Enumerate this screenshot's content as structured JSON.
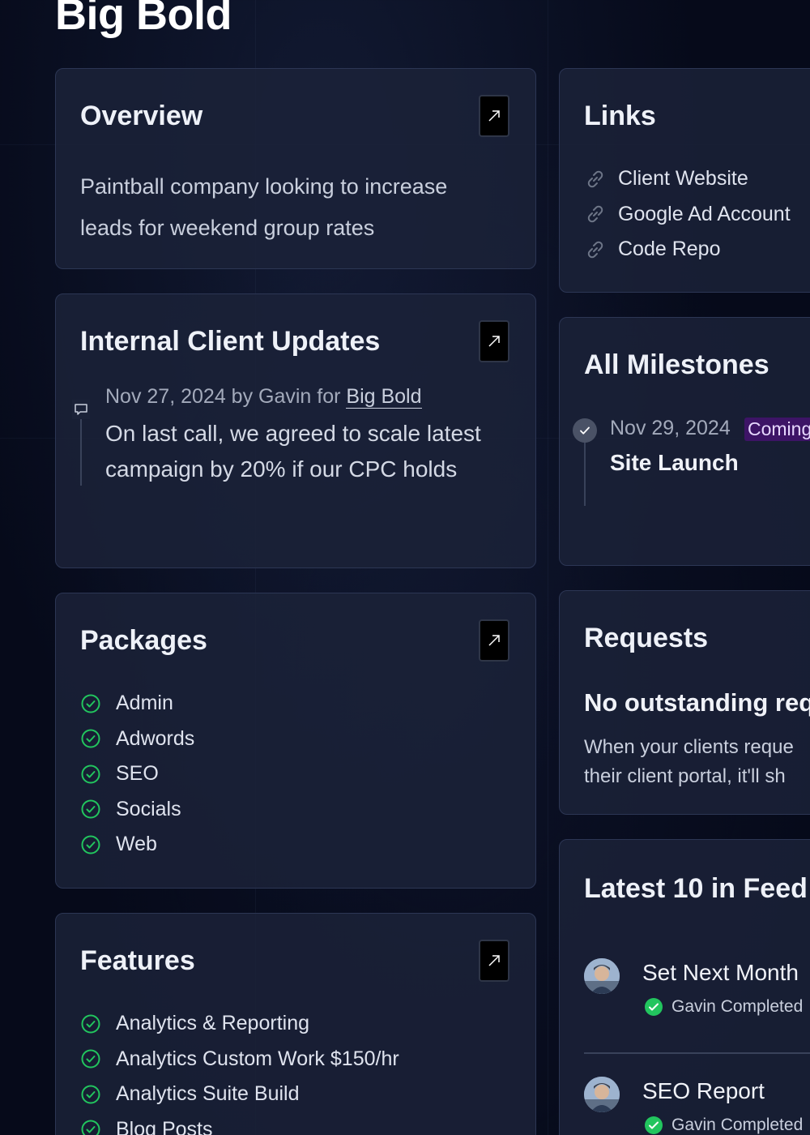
{
  "page": {
    "title": "Big Bold"
  },
  "overview": {
    "title": "Overview",
    "description": "Paintball company looking to increase leads for weekend group rates"
  },
  "links": {
    "title": "Links",
    "items": [
      {
        "label": "Client Website",
        "icon": "link-icon"
      },
      {
        "label": "Google Ad Account",
        "icon": "link-icon"
      },
      {
        "label": "Code Repo",
        "icon": "link-icon"
      }
    ]
  },
  "updates": {
    "title": "Internal Client Updates",
    "items": [
      {
        "meta_prefix": "Nov 27, 2024 by Gavin for ",
        "client_link": "Big Bold",
        "body": "On last call, we agreed to scale latest campaign by 20% if our CPC holds",
        "icon": "chat-bubble-icon"
      }
    ]
  },
  "milestones": {
    "title": "All Milestones",
    "items": [
      {
        "date": "Nov 29, 2024",
        "badge": "Coming",
        "name": "Site Launch",
        "icon": "check-icon"
      }
    ]
  },
  "packages": {
    "title": "Packages",
    "items": [
      "Admin",
      "Adwords",
      "SEO",
      "Socials",
      "Web"
    ]
  },
  "requests": {
    "title": "Requests",
    "empty_title": "No outstanding req",
    "empty_line1": "When your clients reque",
    "empty_line2": "their client portal, it'll sh"
  },
  "features": {
    "title": "Features",
    "items": [
      "Analytics & Reporting",
      "Analytics Custom Work $150/hr",
      "Analytics Suite Build",
      "Blog Posts"
    ]
  },
  "feed": {
    "title": "Latest 10 in Feed",
    "items": [
      {
        "title": "Set Next Month",
        "status": "Gavin Completed"
      },
      {
        "title": "SEO Report",
        "status": "Gavin Completed"
      }
    ]
  },
  "colors": {
    "background": "#060a1a",
    "card": "#1b2238",
    "card_border": "#2c3654",
    "check_green": "#22c55e",
    "badge_purple": "#3d1466"
  }
}
